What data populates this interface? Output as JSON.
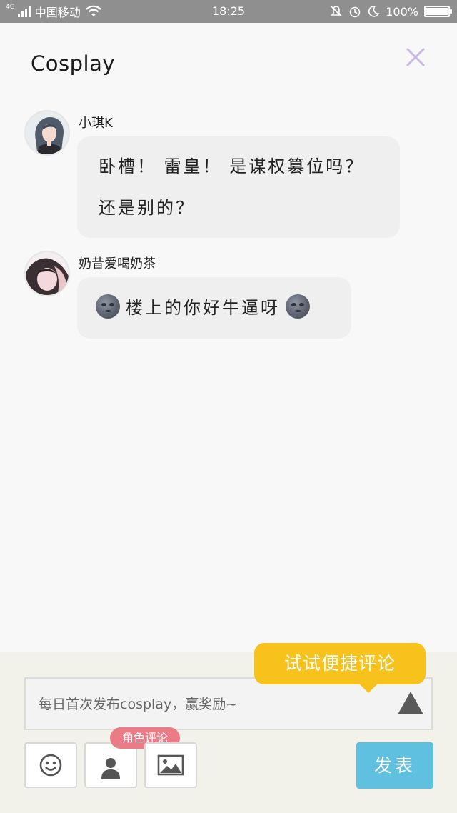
{
  "status_bar": {
    "network_type": "4G",
    "carrier": "中国移动",
    "time": "18:25",
    "battery": "100%",
    "battery_level": 1.0
  },
  "header": {
    "title": "Cosplay"
  },
  "messages": [
    {
      "username": "小琪K",
      "lines": [
        "卧槽！ 雷皇！ 是谋权篡位吗？",
        "还是别的？"
      ]
    },
    {
      "username": "奶昔爱喝奶茶",
      "text": "楼上的你好牛逼呀"
    }
  ],
  "composer": {
    "placeholder": "每日首次发布cosplay，赢奖励~",
    "tooltip": "试试便捷评论",
    "role_badge": "角色评论",
    "publish_label": "发表"
  },
  "colors": {
    "accent_blue": "#5fc0e0",
    "tooltip_yellow": "#f7c21c",
    "badge_pink": "#ea7b87",
    "close_purple": "#c9b7e8"
  }
}
